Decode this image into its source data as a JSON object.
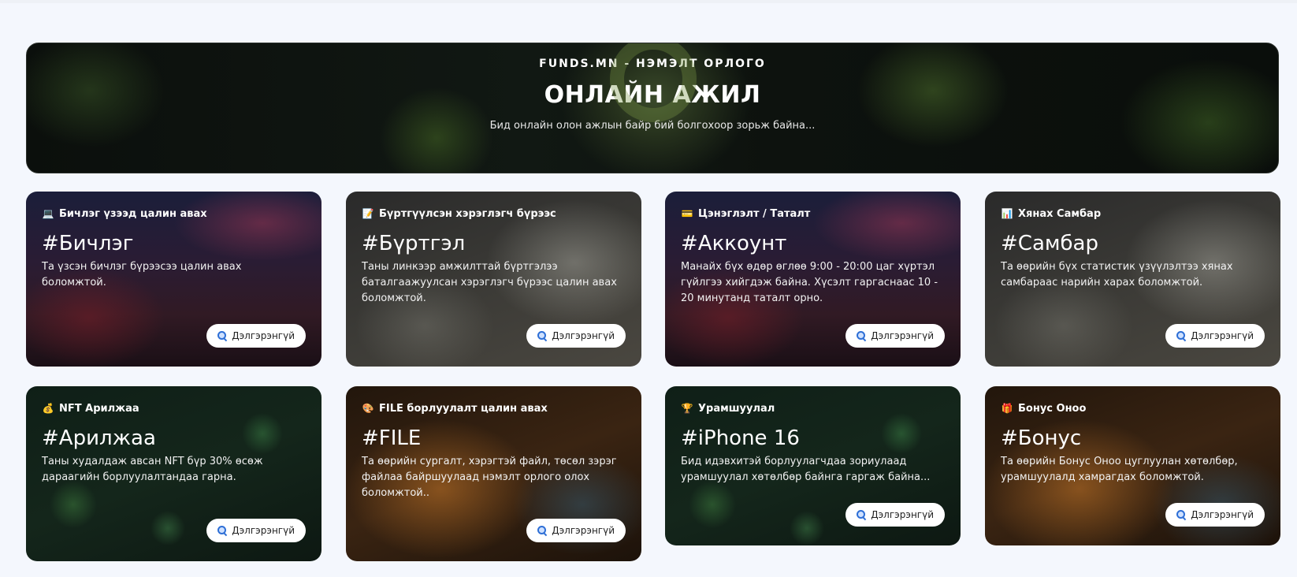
{
  "hero": {
    "eyebrow": "FUNDS.MN - НЭМЭЛТ ОРЛОГО",
    "title": "ОНЛАЙН АЖИЛ",
    "subtitle": "Бид онлайн олон ажлын байр бий болгохоор зорьж байна..."
  },
  "button_label": "Дэлгэрэнгүй",
  "cards": [
    {
      "icon": "💻",
      "icon_name": "laptop-icon",
      "tag": "Бичлэг үзээд цалин авах",
      "title": "#Бичлэг",
      "desc": "Та үзсэн бичлэг бүрээсээ цалин авах боломжтой."
    },
    {
      "icon": "📝",
      "icon_name": "memo-icon",
      "tag": "Бүртгүүлсэн хэрэглэгч бүрээс",
      "title": "#Бүртгэл",
      "desc": "Таны линкээр амжилттай бүртгэлээ баталгаажуулсан хэрэглэгч бүрээс цалин авах боломжтой."
    },
    {
      "icon": "💳",
      "icon_name": "credit-card-icon",
      "tag": "Цэнэглэлт / Таталт",
      "title": "#Аккоунт",
      "desc": "Манайх бүх өдөр өглөө 9:00 - 20:00 цаг хүртэл гүйлгээ хийгдэж байна. Хүсэлт гаргаснаас 10 - 20 минутанд таталт орно."
    },
    {
      "icon": "📊",
      "icon_name": "bar-chart-icon",
      "tag": "Хянах Самбар",
      "title": "#Самбар",
      "desc": "Та өөрийн бүх статистик үзүүлэлтээ хянах самбараас нарийн харах боломжтой."
    },
    {
      "icon": "💰",
      "icon_name": "money-bag-icon",
      "tag": "NFT Арилжаа",
      "title": "#Арилжаа",
      "desc": "Таны худалдаж авсан NFT бүр 30% өсөж дараагийн борлуулалтандаа гарна."
    },
    {
      "icon": "🎨",
      "icon_name": "palette-icon",
      "tag": "FILE борлуулалт цалин авах",
      "title": "#FILE",
      "desc": "Та өөрийн сургалт, хэрэгтэй файл, төсөл зэрэг файлаа байршуулаад нэмэлт орлого олох боломжтой.."
    },
    {
      "icon": "🏆",
      "icon_name": "trophy-icon",
      "tag": "Урамшуулал",
      "title": "#iPhone 16",
      "desc": "Бид идэвхитэй борлуулагчдаа зориулаад урамшуулал хөтөлбөр байнга гаргаж байна..."
    },
    {
      "icon": "🎁",
      "icon_name": "gift-icon",
      "tag": "Бонус Оноо",
      "title": "#Бонус",
      "desc": "Та өөрийн Бонус Оноо цуглуулан хөтөлбөр, урамшуулалд хамрагдах боломжтой."
    }
  ]
}
